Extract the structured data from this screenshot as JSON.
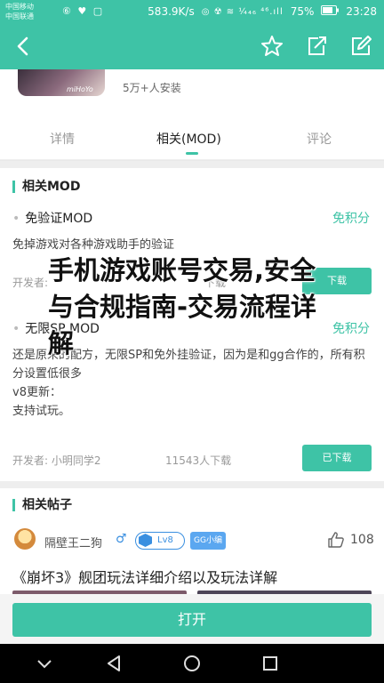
{
  "status_bar": {
    "carrier_1": "中国移动",
    "carrier_2": "中国联通",
    "left_icons": "⑥ ♥ ▢",
    "speed": "583.9K/s",
    "glyphs": "◎ ☢ ≋ ¼₄₆ ⁴⁶.ıll",
    "battery": "75%",
    "time": "23:28"
  },
  "app_bar": {
    "back_icon": "chevron-left-icon",
    "actions": [
      "star-icon",
      "share-icon",
      "edit-icon"
    ]
  },
  "app_info": {
    "thumb_text": "miHoYo",
    "install_count": "5万+人安装"
  },
  "tabs": [
    {
      "label": "详情"
    },
    {
      "label": "相关(MOD)"
    },
    {
      "label": "评论"
    }
  ],
  "mod_section": {
    "title": "相关MOD",
    "items": [
      {
        "name": "免验证MOD",
        "price": "免积分",
        "desc": "免掉游戏对各种游戏助手的验证",
        "developer": "开发者:",
        "downloads": "下载",
        "button": "下载"
      },
      {
        "name": "无限SP MOD",
        "price": "免积分",
        "desc": "还是原来的配方，无限SP和免外挂验证，因为是和gg合作的，所有积分设置低很多\nv8更新：\n支持试玩。",
        "developer": "开发者: 小明同学2",
        "downloads": "11543人下载",
        "button": "已下载"
      }
    ]
  },
  "overlay": {
    "title": "手机游戏账号交易,安全与合规指南-交易流程详解"
  },
  "posts_section": {
    "title": "相关帖子",
    "poster_name": "隔壁王二狗",
    "gender": "♂",
    "level": "Lv8",
    "group": "GG小编",
    "likes": "108",
    "post_title": "《崩坏3》舰团玩法详细介绍以及玩法详解"
  },
  "bottom": {
    "open_button": "打开"
  },
  "nav_bar": {
    "buttons": [
      "back-nav-icon",
      "home-nav-icon",
      "recents-nav-icon",
      "menu-down-icon"
    ]
  },
  "colors": {
    "accent": "#3ec3a6",
    "badge_blue": "#3a8fe0"
  }
}
